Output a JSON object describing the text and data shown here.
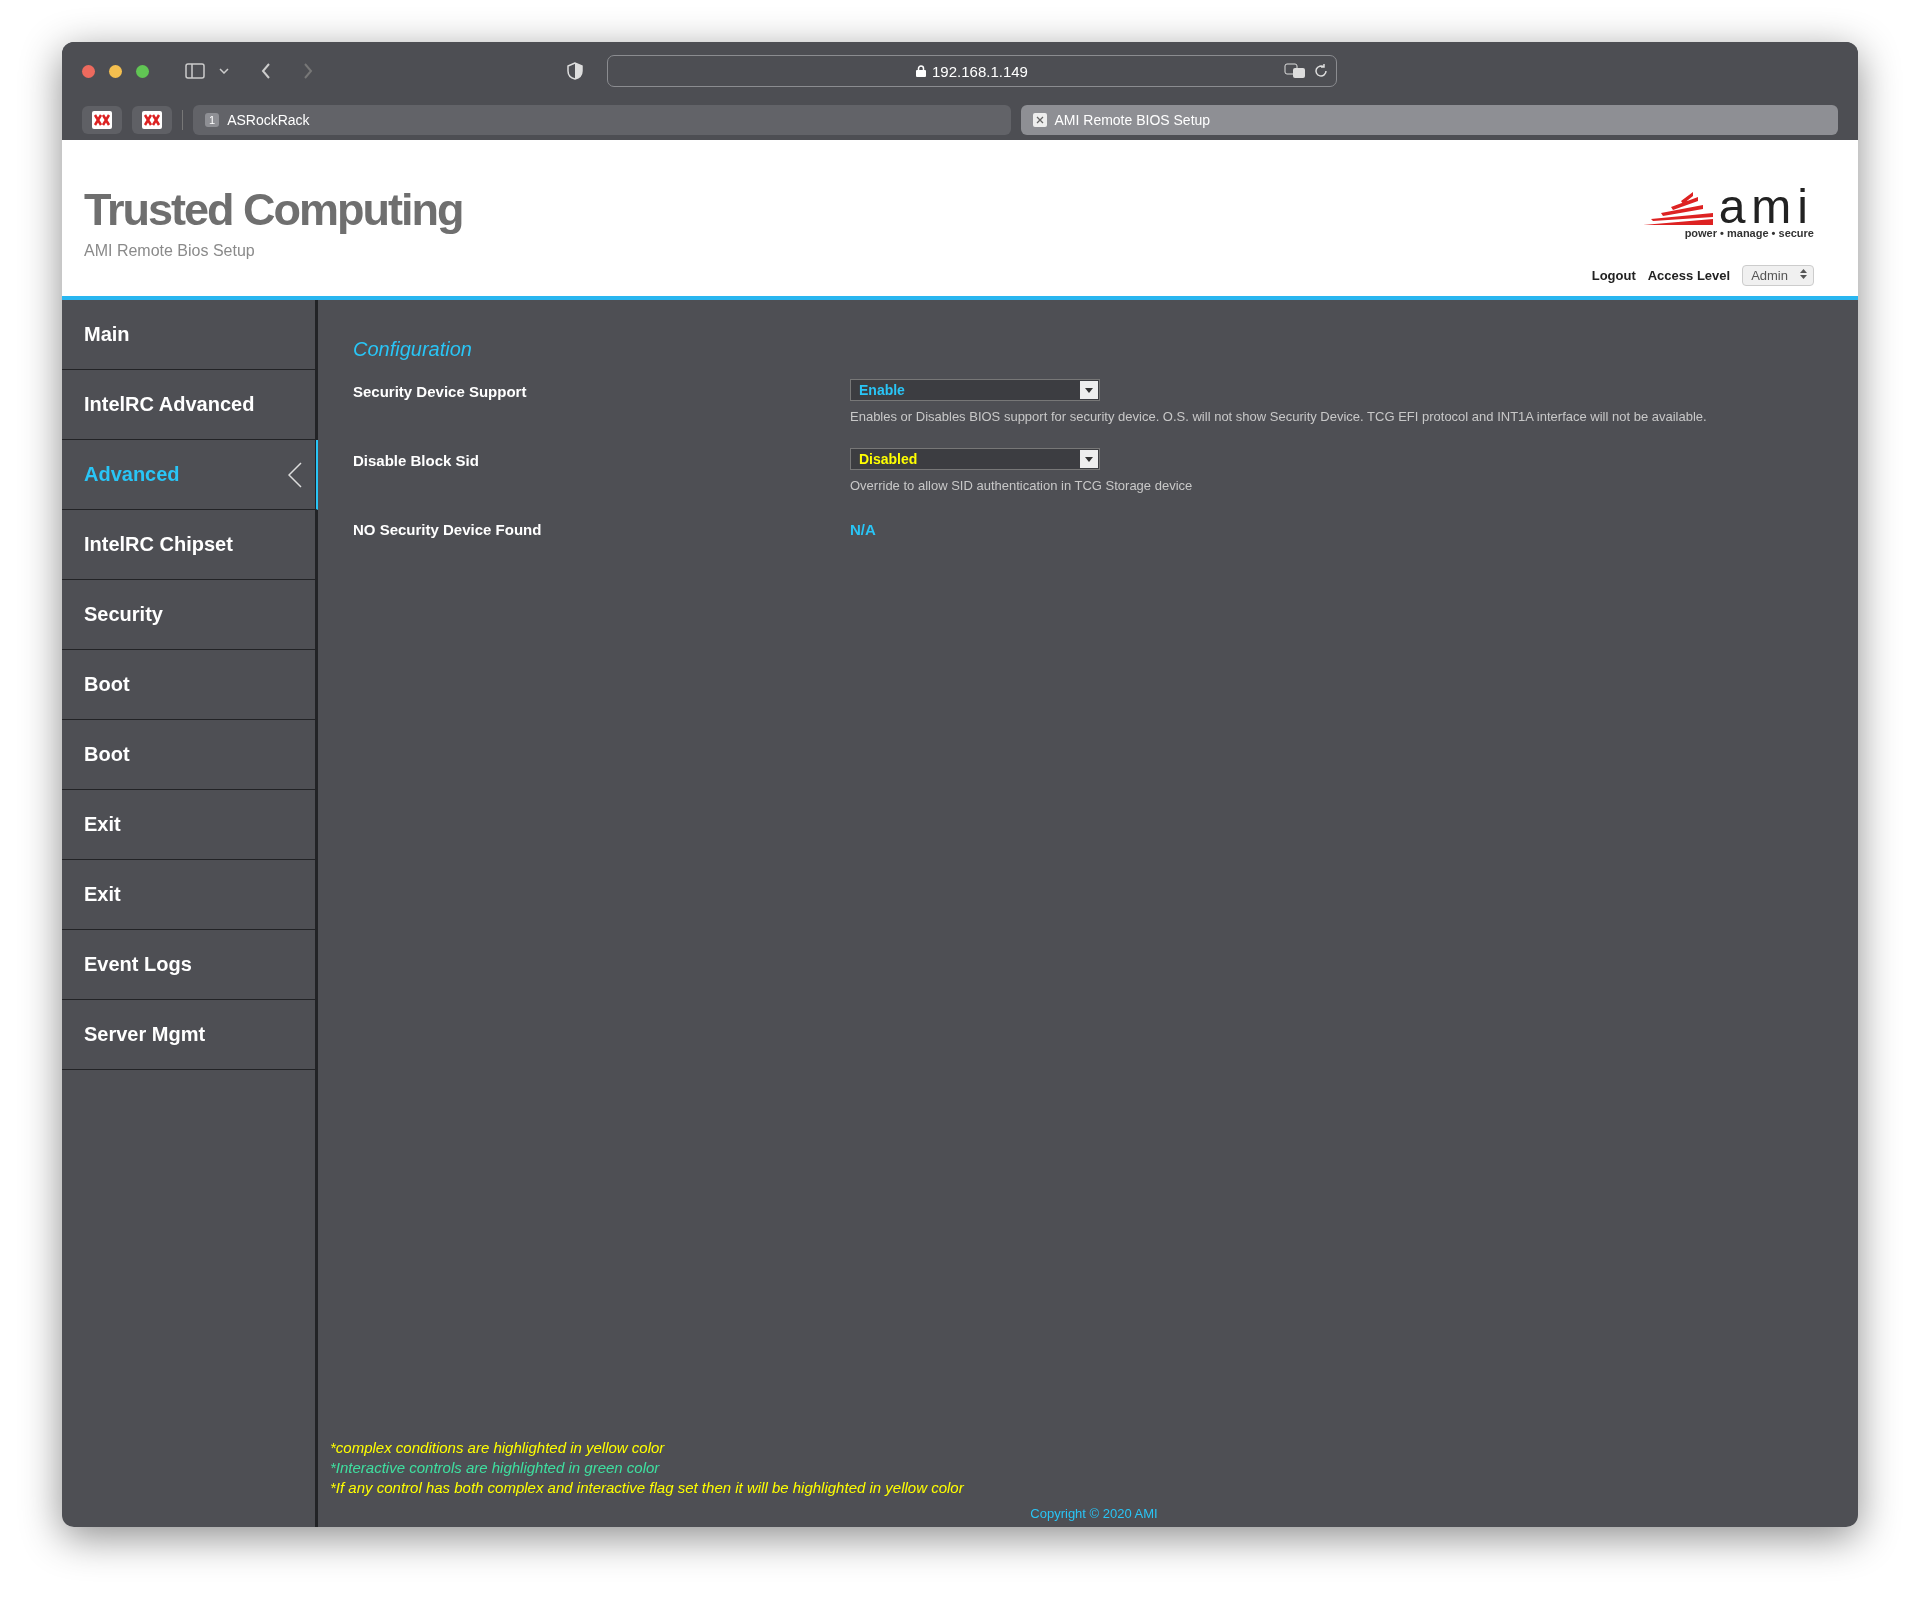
{
  "browser": {
    "address": "192.168.1.149",
    "pinned_tabs": [
      {
        "kind": "favicon"
      },
      {
        "kind": "favicon"
      }
    ],
    "tabs": [
      {
        "label": "ASRockRack",
        "badge": "1",
        "selected": false
      },
      {
        "label": "AMI Remote BIOS Setup",
        "selected": true
      }
    ]
  },
  "header": {
    "title": "Trusted Computing",
    "subtitle": "AMI Remote Bios Setup",
    "logo": {
      "text": "ami",
      "tagline": "power • manage • secure"
    },
    "logout": "Logout",
    "access_level_label": "Access Level",
    "access_level": "Admin"
  },
  "sidebar": {
    "items": [
      {
        "label": "Main",
        "selected": false
      },
      {
        "label": "IntelRC Advanced",
        "selected": false
      },
      {
        "label": "Advanced",
        "selected": true
      },
      {
        "label": "IntelRC Chipset",
        "selected": false
      },
      {
        "label": "Security",
        "selected": false
      },
      {
        "label": "Boot",
        "selected": false
      },
      {
        "label": "Boot",
        "selected": false
      },
      {
        "label": "Exit",
        "selected": false
      },
      {
        "label": "Exit",
        "selected": false
      },
      {
        "label": "Event Logs",
        "selected": false
      },
      {
        "label": "Server Mgmt",
        "selected": false
      }
    ]
  },
  "content": {
    "heading": "Configuration",
    "settings": [
      {
        "kind": "select",
        "label": "Security Device Support",
        "value": "Enable",
        "color": "#29c5f6",
        "help": "Enables or Disables BIOS support for security device. O.S. will not show Security Device. TCG EFI protocol and INT1A interface will not be available."
      },
      {
        "kind": "select",
        "label": "Disable Block Sid",
        "value": "Disabled",
        "color": "#ffff00",
        "help": "Override to allow SID authentication in TCG Storage device"
      },
      {
        "kind": "text",
        "label": "NO Security Device Found",
        "value": "N/A",
        "color": "#29c5f6"
      }
    ]
  },
  "notes": [
    {
      "text": "*complex conditions are highlighted in yellow color",
      "color": "#ffff00"
    },
    {
      "text": "*Interactive controls are highlighted in green color",
      "color": "#3ee0a0"
    },
    {
      "text": "*If any control has both complex and interactive flag set then it will be highlighted in yellow color",
      "color": "#ffff00"
    }
  ],
  "copyright": "Copyright © 2020 AMI"
}
